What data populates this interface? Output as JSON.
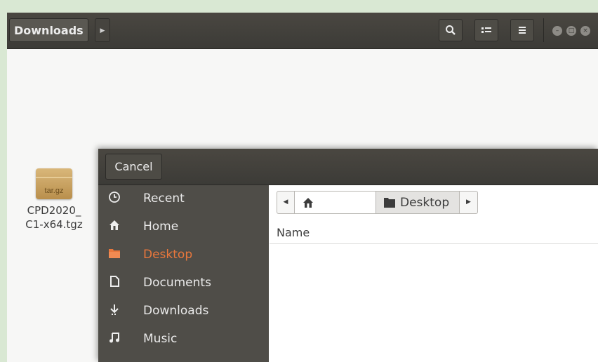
{
  "window": {
    "location": "Downloads",
    "toolbar": {
      "search_icon": "search-icon",
      "view_icon": "list-view-icon",
      "menu_icon": "hamburger-menu-icon"
    }
  },
  "files": [
    {
      "name_line1": "CPD2020_",
      "name_line2": "C1-x64.tgz",
      "badge": "tar.gz"
    }
  ],
  "dialog": {
    "cancel_label": "Cancel",
    "sidebar": [
      {
        "label": "Recent",
        "icon": "clock-icon",
        "active": false
      },
      {
        "label": "Home",
        "icon": "home-icon",
        "active": false
      },
      {
        "label": "Desktop",
        "icon": "folder-icon",
        "active": true
      },
      {
        "label": "Documents",
        "icon": "document-icon",
        "active": false
      },
      {
        "label": "Downloads",
        "icon": "download-icon",
        "active": false
      },
      {
        "label": "Music",
        "icon": "music-icon",
        "active": false
      }
    ],
    "pathbar": {
      "current": "Desktop"
    },
    "columns": {
      "name": "Name"
    }
  },
  "colors": {
    "accent": "#e9773c",
    "header_bg": "#3c3b37",
    "sidebar_bg": "#4f4d48"
  }
}
